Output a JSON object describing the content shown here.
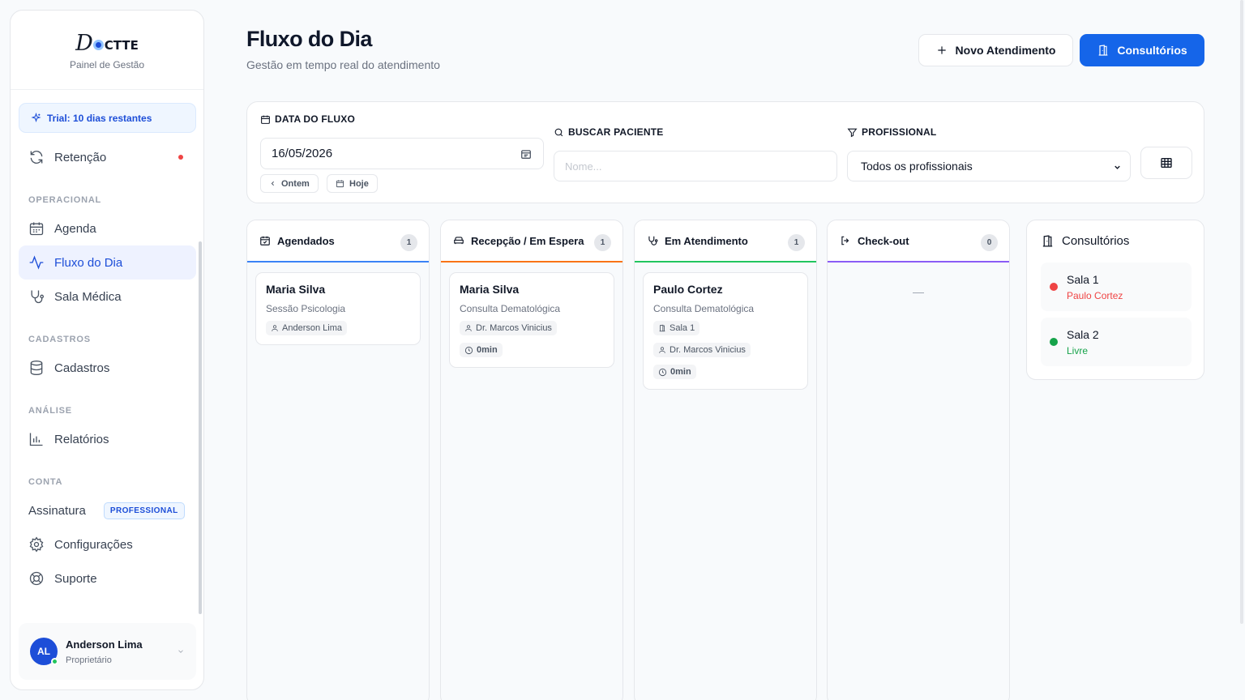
{
  "brand": {
    "logo_d": "D",
    "logo_rest": "CTTE",
    "subtitle": "Painel de Gestão"
  },
  "trial": {
    "label": "Trial: 10 dias restantes"
  },
  "sidebar": {
    "retencao": "Retenção",
    "sections": {
      "operacional": "OPERACIONAL",
      "cadastros": "CADASTROS",
      "analise": "ANÁLISE",
      "conta": "CONTA"
    },
    "items": {
      "agenda": "Agenda",
      "fluxo": "Fluxo do Dia",
      "sala_medica": "Sala Médica",
      "cadastros": "Cadastros",
      "relatorios": "Relatórios",
      "assinatura": "Assinatura",
      "configuracoes": "Configurações",
      "suporte": "Suporte"
    },
    "plan_badge": "PROFESSIONAL"
  },
  "user": {
    "initials": "AL",
    "name": "Anderson Lima",
    "role": "Proprietário"
  },
  "header": {
    "title": "Fluxo do Dia",
    "subtitle": "Gestão em tempo real do atendimento",
    "new_button": "Novo Atendimento",
    "rooms_button": "Consultórios"
  },
  "filters": {
    "date_label": "DATA DO FLUXO",
    "date_value": "16/05/2026",
    "yesterday": "Ontem",
    "today": "Hoje",
    "search_label": "BUSCAR PACIENTE",
    "search_placeholder": "Nome...",
    "prof_label": "PROFISSIONAL",
    "prof_value": "Todos os profissionais"
  },
  "columns": {
    "agendados": {
      "title": "Agendados",
      "count": "1",
      "color": "#3b82f6",
      "card": {
        "name": "Maria Silva",
        "procedure": "Sessão Psicologia",
        "professional": "Anderson Lima"
      }
    },
    "recepcao": {
      "title": "Recepção / Em Espera",
      "count": "1",
      "color": "#f97316",
      "card": {
        "name": "Maria Silva",
        "procedure": "Consulta Dematológica",
        "professional": "Dr. Marcos Vinicius",
        "wait": "0min"
      }
    },
    "atendimento": {
      "title": "Em Atendimento",
      "count": "1",
      "color": "#22c55e",
      "card": {
        "name": "Paulo Cortez",
        "procedure": "Consulta Dematológica",
        "room": "Sala 1",
        "professional": "Dr. Marcos Vinicius",
        "wait": "0min"
      }
    },
    "checkout": {
      "title": "Check-out",
      "count": "0",
      "color": "#8b5cf6",
      "empty": "—"
    }
  },
  "rooms": {
    "title": "Consultórios",
    "list": [
      {
        "name": "Sala 1",
        "status": "Paulo Cortez",
        "color": "#ef4444"
      },
      {
        "name": "Sala 2",
        "status": "Livre",
        "color": "#16a34a"
      }
    ]
  }
}
